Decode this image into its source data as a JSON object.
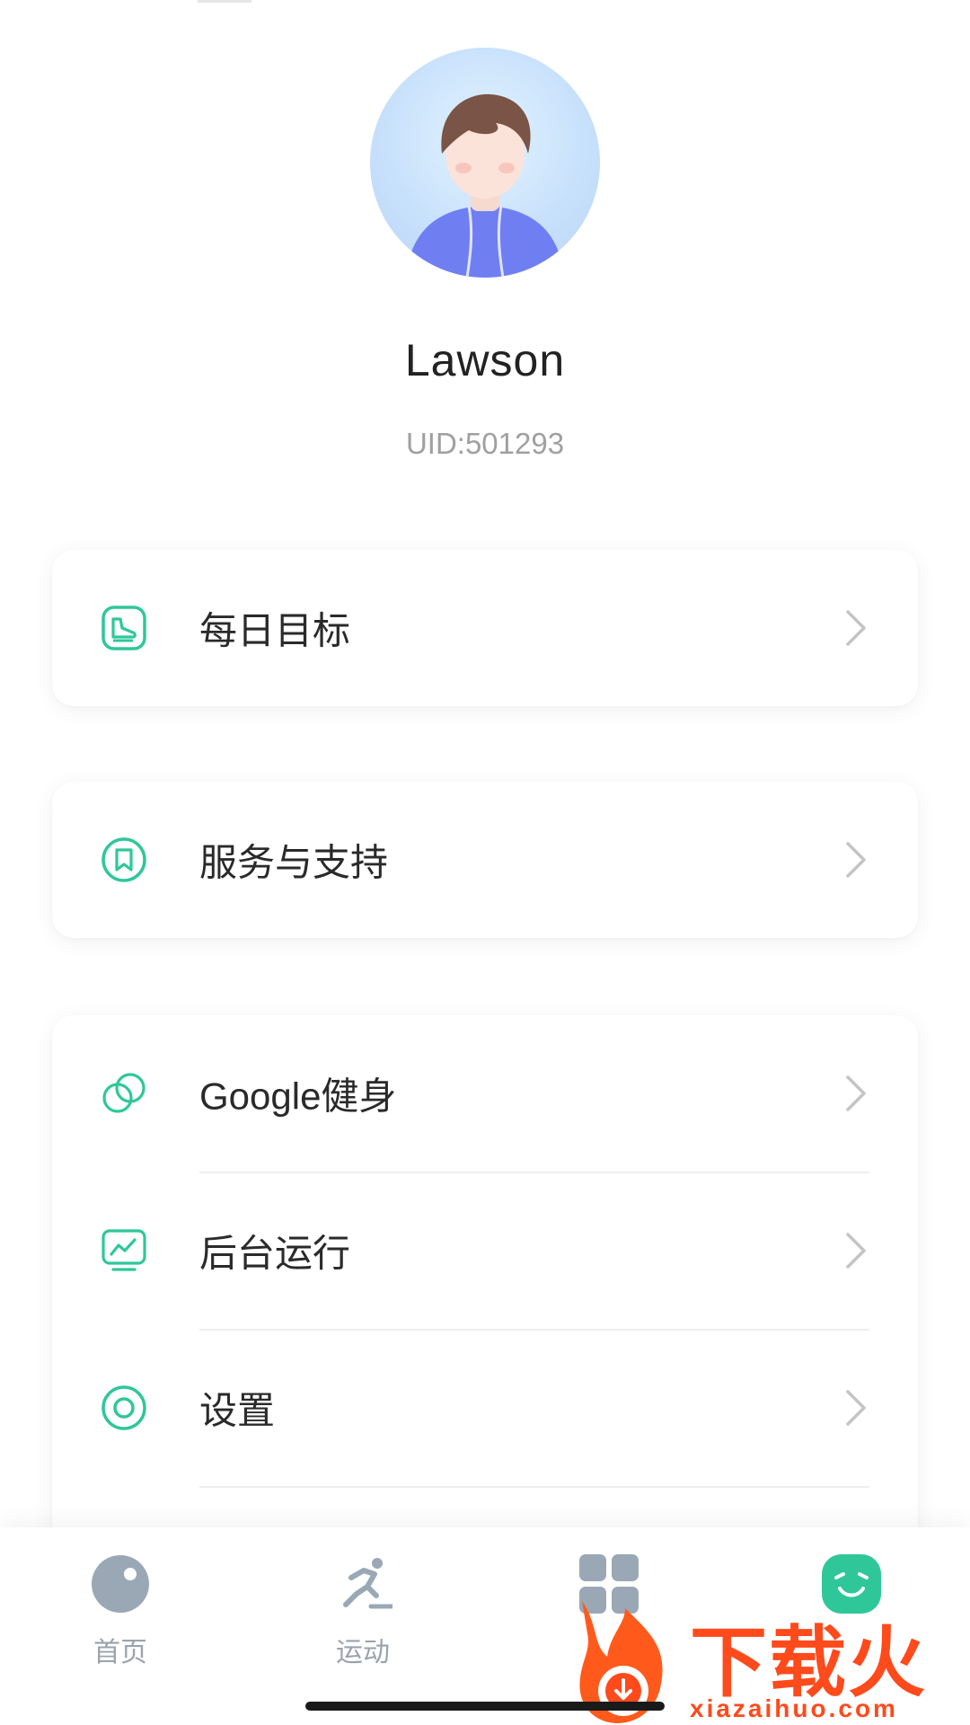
{
  "profile": {
    "name": "Lawson",
    "uid": "UID:501293"
  },
  "menu": {
    "daily_goal": {
      "label": "每日目标",
      "icon": "shoe-icon"
    },
    "service_support": {
      "label": "服务与支持",
      "icon": "bookmark-icon"
    },
    "google_fit": {
      "label": "Google健身",
      "icon": "overlap-circles-icon"
    },
    "background_run": {
      "label": "后台运行",
      "icon": "monitor-chart-icon"
    },
    "settings": {
      "label": "设置",
      "icon": "ring-icon"
    }
  },
  "nav": {
    "home": "首页",
    "sport": "运动",
    "apps": "",
    "profile": ""
  },
  "watermark": {
    "title": "下载火",
    "url": "xiazaihuo.com"
  },
  "colors": {
    "accent": "#2fc79a",
    "nav_inactive": "#9aa3ad",
    "nav_active": "#2fc79a",
    "watermark": "#ff4a1c"
  }
}
